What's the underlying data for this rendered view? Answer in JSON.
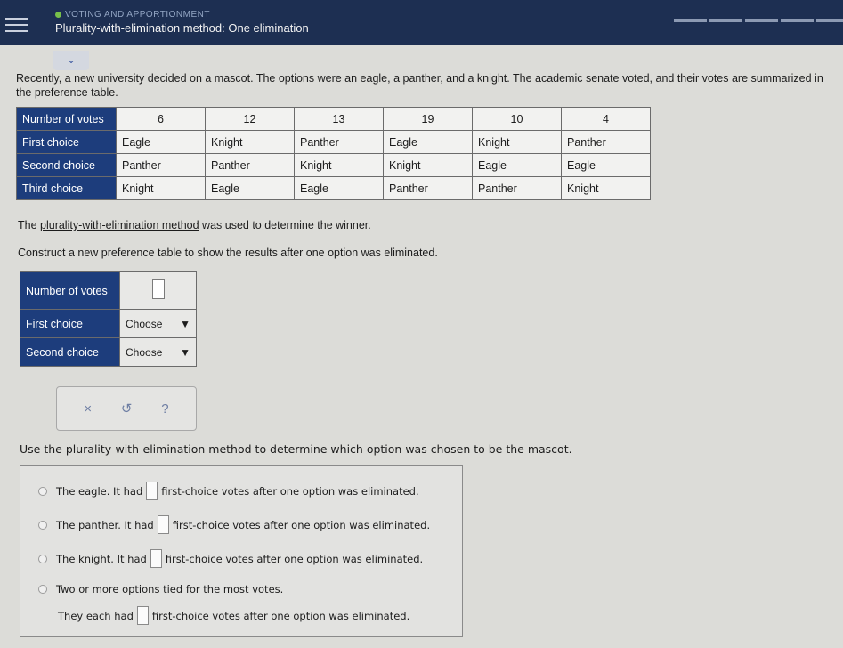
{
  "header": {
    "topic": "VOTING AND APPORTIONMENT",
    "title": "Plurality-with-elimination method: One elimination",
    "progress_segments": 5
  },
  "intro": "Recently, a new university decided on a mascot. The options were an eagle, a panther, and a knight. The academic senate voted, and their votes are summarized in the preference table.",
  "preference_table": {
    "row_labels": [
      "Number of votes",
      "First choice",
      "Second choice",
      "Third choice"
    ],
    "votes": [
      "6",
      "12",
      "13",
      "19",
      "10",
      "4"
    ],
    "first": [
      "Eagle",
      "Knight",
      "Panther",
      "Eagle",
      "Knight",
      "Panther"
    ],
    "second": [
      "Panther",
      "Panther",
      "Knight",
      "Knight",
      "Eagle",
      "Eagle"
    ],
    "third": [
      "Knight",
      "Eagle",
      "Eagle",
      "Panther",
      "Panther",
      "Knight"
    ]
  },
  "method_line": {
    "prefix": "The ",
    "link": "plurality-with-elimination method",
    "suffix": " was used to determine the winner."
  },
  "construct_line": "Construct a new preference table to show the results after one option was eliminated.",
  "new_table": {
    "labels": [
      "Number of votes",
      "First choice",
      "Second choice"
    ],
    "select_value": "Choose"
  },
  "toolbar": {
    "clear": "×",
    "undo": "↺",
    "help": "?"
  },
  "question": "Use the plurality-with-elimination method to determine which option was chosen to be the mascot.",
  "options": {
    "eagle": {
      "before": "The eagle. It had",
      "after": "first-choice votes after one option was eliminated."
    },
    "panther": {
      "before": "The panther. It had",
      "after": "first-choice votes after one option was eliminated."
    },
    "knight": {
      "before": "The knight. It had",
      "after": "first-choice votes after one option was eliminated."
    },
    "tie": {
      "text": "Two or more options tied for the most votes.",
      "before": "They each had",
      "after": "first-choice votes after one option was eliminated."
    }
  },
  "colors": {
    "header_bg": "#1d2f52",
    "label_bg": "#1d3d7c",
    "accent": "#3b57a0"
  }
}
